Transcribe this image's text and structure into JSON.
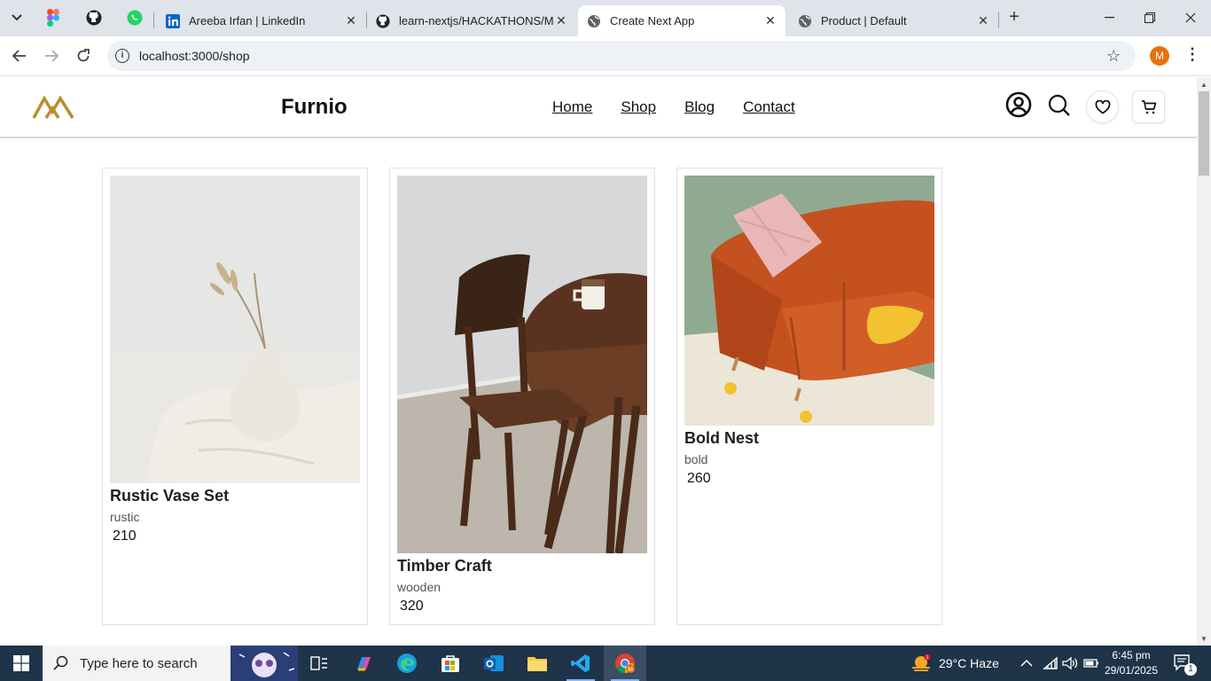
{
  "browser": {
    "tabs": [
      {
        "title": "Areeba Irfan | LinkedIn",
        "icon": "linkedin-icon",
        "active": false
      },
      {
        "title": "learn-nextjs/HACKATHONS/Ma",
        "icon": "github-icon",
        "active": false
      },
      {
        "title": "Create Next App",
        "icon": "globe-icon",
        "active": true
      },
      {
        "title": "Product | Default",
        "icon": "globe-icon",
        "active": false
      }
    ],
    "pinned": [
      "figma-icon",
      "github-icon",
      "whatsapp-icon"
    ],
    "url": "localhost:3000/shop",
    "profile_initial": "M",
    "accent_color": "#e8710a"
  },
  "site": {
    "brand": "Furnio",
    "logo_color": "#b88e2f",
    "nav": [
      "Home",
      "Shop",
      "Blog",
      "Contact"
    ],
    "header_icons": [
      "user-icon",
      "search-icon",
      "heart-icon",
      "cart-icon"
    ]
  },
  "products": [
    {
      "name": "Rustic Vase Set",
      "category": "rustic",
      "price": "210"
    },
    {
      "name": "Timber Craft",
      "category": "wooden",
      "price": "320"
    },
    {
      "name": "Bold Nest",
      "category": "bold",
      "price": "260"
    }
  ],
  "taskbar": {
    "search_placeholder": "Type here to search",
    "weather": "29°C  Haze",
    "time": "6:45 pm",
    "date": "29/01/2025",
    "notification_count": "1"
  }
}
